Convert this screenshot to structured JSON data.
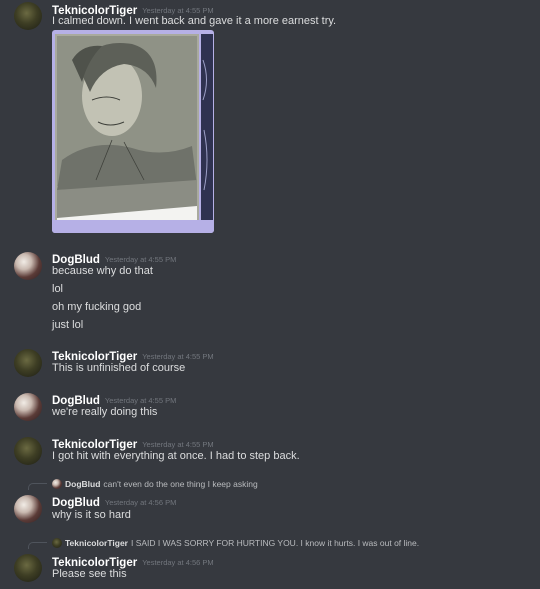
{
  "messages": [
    {
      "username": "TeknicolorTiger",
      "timestamp": "Yesterday at 4:55 PM",
      "lines": [
        "I calmed down. I went back and gave it a more earnest try."
      ],
      "attachment": "sketch-image"
    },
    {
      "username": "DogBlud",
      "timestamp": "Yesterday at 4:55 PM",
      "lines": [
        "because why do that",
        "lol",
        "oh my fucking god",
        "just lol"
      ]
    },
    {
      "username": "TeknicolorTiger",
      "timestamp": "Yesterday at 4:55 PM",
      "lines": [
        "This is unfinished of course"
      ]
    },
    {
      "username": "DogBlud",
      "timestamp": "Yesterday at 4:55 PM",
      "lines": [
        "we're really doing this"
      ]
    },
    {
      "username": "TeknicolorTiger",
      "timestamp": "Yesterday at 4:55 PM",
      "lines": [
        "I got hit with everything at once. I had to step back."
      ]
    },
    {
      "reply": {
        "username": "DogBlud",
        "text": "can't even do the one thing I keep asking"
      },
      "username": "DogBlud",
      "timestamp": "Yesterday at 4:56 PM",
      "lines": [
        "why is it so hard"
      ]
    },
    {
      "reply": {
        "username": "TeknicolorTiger",
        "text": "I SAID I WAS SORRY FOR HURTING YOU. I know it hurts. I was out of line."
      },
      "username": "TeknicolorTiger",
      "timestamp": "Yesterday at 4:56 PM",
      "lines": [
        "Please see this"
      ]
    }
  ],
  "colors": {
    "background": "#36393f",
    "username": "#ffffff",
    "message_text": "#dcddde",
    "timestamp": "#72767d",
    "attachment_frame": "#b6b0e6"
  }
}
